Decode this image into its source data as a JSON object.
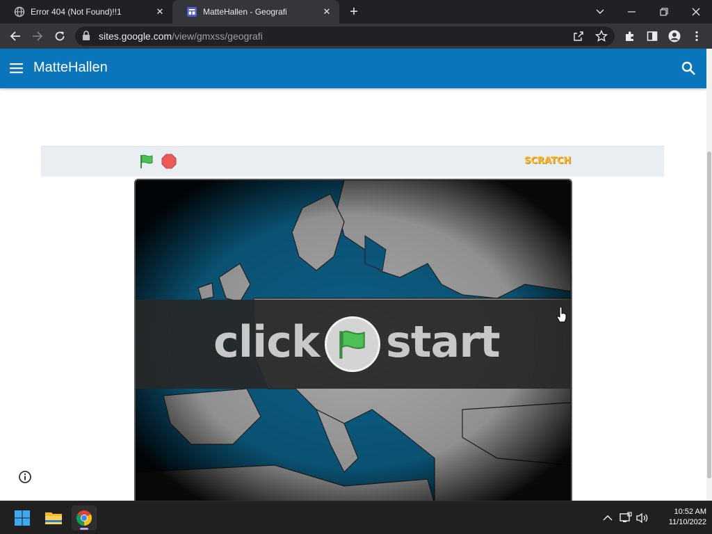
{
  "browser": {
    "tabs": [
      {
        "title": "Error 404 (Not Found)!!1",
        "active": false
      },
      {
        "title": "MatteHallen - Geografi",
        "active": true
      }
    ],
    "url_host": "sites.google.com",
    "url_path": "/view/gmxss/geografi"
  },
  "site": {
    "title": "MatteHallen",
    "header_color": "#0a75bb"
  },
  "scratch": {
    "logo_text": "SCRATCH",
    "overlay_word_left": "click",
    "overlay_word_right": "start",
    "flag_color": "#4cbf56",
    "stop_color": "#ec5959"
  },
  "taskbar": {
    "time": "10:52 AM",
    "date": "11/10/2022"
  }
}
